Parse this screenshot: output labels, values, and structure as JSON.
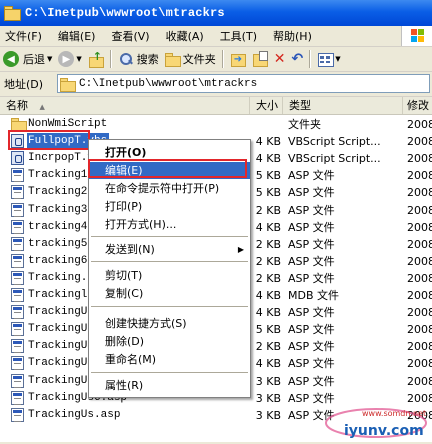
{
  "window": {
    "title": "C:\\Inetpub\\wwwroot\\mtrackrs"
  },
  "menu": [
    "文件(F)",
    "编辑(E)",
    "查看(V)",
    "收藏(A)",
    "工具(T)",
    "帮助(H)"
  ],
  "toolbar": {
    "back": "后退",
    "search": "搜索",
    "folders": "文件夹"
  },
  "address": {
    "label": "地址(D)",
    "value": "C:\\Inetpub\\wwwroot\\mtrackrs"
  },
  "columns": {
    "name": "名称",
    "size": "大小",
    "type": "类型",
    "modified": "修改"
  },
  "files": [
    {
      "name": "NonWmiScript",
      "size": "",
      "type": "文件夹",
      "date": "2008",
      "icon": "folder"
    },
    {
      "name": "FullpopT.vbs",
      "size": "4 KB",
      "type": "VBScript Script...",
      "date": "2008",
      "icon": "vbs",
      "selected": true
    },
    {
      "name": "IncrpopT.vbs",
      "size": "4 KB",
      "type": "VBScript Script...",
      "date": "2008",
      "icon": "vbs"
    },
    {
      "name": "Tracking1.asp",
      "size": "5 KB",
      "type": "ASP 文件",
      "date": "2008",
      "icon": "file"
    },
    {
      "name": "Tracking2.asp",
      "size": "5 KB",
      "type": "ASP 文件",
      "date": "2008",
      "icon": "file"
    },
    {
      "name": "Tracking3.asp",
      "size": "2 KB",
      "type": "ASP 文件",
      "date": "2008",
      "icon": "file"
    },
    {
      "name": "tracking4.asp",
      "size": "4 KB",
      "type": "ASP 文件",
      "date": "2008",
      "icon": "file"
    },
    {
      "name": "tracking5.asp",
      "size": "2 KB",
      "type": "ASP 文件",
      "date": "2008",
      "icon": "file"
    },
    {
      "name": "tracking6.asp",
      "size": "2 KB",
      "type": "ASP 文件",
      "date": "2008",
      "icon": "file"
    },
    {
      "name": "Tracking.asp",
      "size": "2 KB",
      "type": "ASP 文件",
      "date": "2008",
      "icon": "file"
    },
    {
      "name": "Trackinglog.mdb",
      "size": "4 KB",
      "type": "MDB 文件",
      "date": "2008",
      "icon": "file"
    },
    {
      "name": "TrackingUs1.asp",
      "size": "4 KB",
      "type": "ASP 文件",
      "date": "2008",
      "icon": "file"
    },
    {
      "name": "TrackingUs2.asp",
      "size": "5 KB",
      "type": "ASP 文件",
      "date": "2008",
      "icon": "file"
    },
    {
      "name": "TrackingUs3.asp",
      "size": "2 KB",
      "type": "ASP 文件",
      "date": "2008",
      "icon": "file"
    },
    {
      "name": "TrackingUs4.asp",
      "size": "4 KB",
      "type": "ASP 文件",
      "date": "2008",
      "icon": "file"
    },
    {
      "name": "TrackingUs5.asp",
      "size": "3 KB",
      "type": "ASP 文件",
      "date": "2008",
      "icon": "file"
    },
    {
      "name": "TrackingUs6.asp",
      "size": "3 KB",
      "type": "ASP 文件",
      "date": "2008",
      "icon": "file"
    },
    {
      "name": "TrackingUs.asp",
      "size": "3 KB",
      "type": "ASP 文件",
      "date": "2008",
      "icon": "file"
    }
  ],
  "context_menu": {
    "open": "打开(O)",
    "edit": "编辑(E)",
    "cmd_open": "在命令提示符中打开(P)",
    "print": "打印(P)",
    "open_with": "打开方式(H)...",
    "send_to": "发送到(N)",
    "cut": "剪切(T)",
    "copy": "复制(C)",
    "create_shortcut": "创建快捷方式(S)",
    "delete": "删除(D)",
    "rename": "重命名(M)",
    "properties": "属性(R)"
  },
  "watermark": {
    "site": "www.somdn.net",
    "brand": "iyunv.com"
  },
  "colors": {
    "title_bar": "#0a5ee6",
    "selection": "#316ac5",
    "highlight_box": "#e2262b"
  }
}
